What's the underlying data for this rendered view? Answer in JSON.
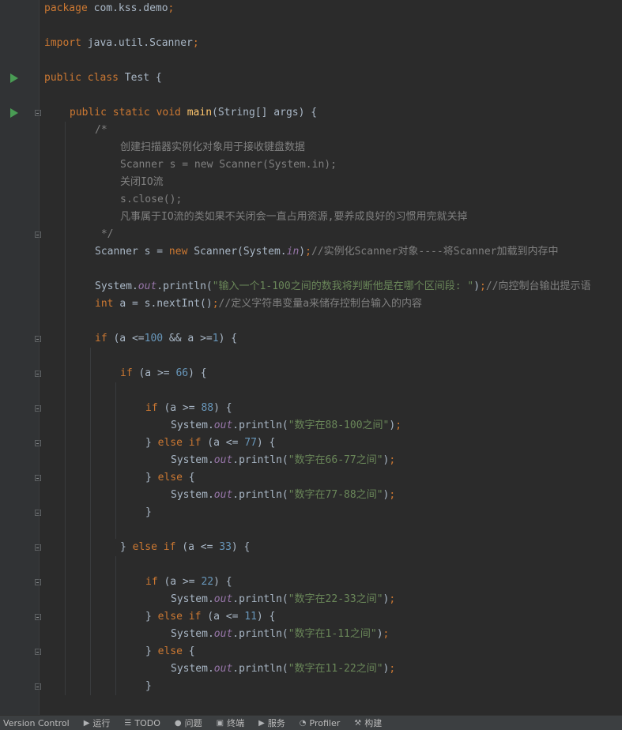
{
  "editor": {
    "lines": [
      {
        "indent": 0,
        "tokens": [
          {
            "t": "package ",
            "c": "kw"
          },
          {
            "t": "com.kss.demo",
            "c": "plain"
          },
          {
            "t": ";",
            "c": "kw"
          }
        ]
      },
      {
        "indent": 0,
        "tokens": []
      },
      {
        "indent": 0,
        "tokens": [
          {
            "t": "import ",
            "c": "kw"
          },
          {
            "t": "java.util.Scanner",
            "c": "plain"
          },
          {
            "t": ";",
            "c": "kw"
          }
        ]
      },
      {
        "indent": 0,
        "tokens": []
      },
      {
        "indent": 0,
        "tokens": [
          {
            "t": "public class ",
            "c": "kw"
          },
          {
            "t": "Test {",
            "c": "plain"
          }
        ]
      },
      {
        "indent": 0,
        "tokens": []
      },
      {
        "indent": 4,
        "tokens": [
          {
            "t": "public static void ",
            "c": "kw"
          },
          {
            "t": "main",
            "c": "fn"
          },
          {
            "t": "(String[] args) {",
            "c": "plain"
          }
        ]
      },
      {
        "indent": 8,
        "tokens": [
          {
            "t": "/*",
            "c": "cmt"
          }
        ]
      },
      {
        "indent": 12,
        "tokens": [
          {
            "t": "创建扫描器实例化对象用于接收键盘数据",
            "c": "cmt"
          }
        ]
      },
      {
        "indent": 12,
        "tokens": [
          {
            "t": "Scanner s = new Scanner(System.in);",
            "c": "cmt"
          }
        ]
      },
      {
        "indent": 12,
        "tokens": [
          {
            "t": "关闭IO流",
            "c": "cmt"
          }
        ]
      },
      {
        "indent": 12,
        "tokens": [
          {
            "t": "s.close();",
            "c": "cmt"
          }
        ]
      },
      {
        "indent": 12,
        "tokens": [
          {
            "t": "凡事属于IO流的类如果不关闭会一直占用资源,要养成良好的习惯用完就关掉",
            "c": "cmt"
          }
        ]
      },
      {
        "indent": 8,
        "tokens": [
          {
            "t": " */",
            "c": "cmt"
          }
        ]
      },
      {
        "indent": 8,
        "tokens": [
          {
            "t": "Scanner s = ",
            "c": "plain"
          },
          {
            "t": "new ",
            "c": "kw"
          },
          {
            "t": "Scanner(System.",
            "c": "plain"
          },
          {
            "t": "in",
            "c": "field"
          },
          {
            "t": ")",
            "c": "plain"
          },
          {
            "t": ";",
            "c": "kw"
          },
          {
            "t": "//实例化Scanner对象----将Scanner加载到内存中",
            "c": "cmt"
          }
        ]
      },
      {
        "indent": 0,
        "tokens": []
      },
      {
        "indent": 8,
        "tokens": [
          {
            "t": "System.",
            "c": "plain"
          },
          {
            "t": "out",
            "c": "field"
          },
          {
            "t": ".println(",
            "c": "plain"
          },
          {
            "t": "\"输入一个1-100之间的数我将判断他是在哪个区间段: \"",
            "c": "str"
          },
          {
            "t": ")",
            "c": "plain"
          },
          {
            "t": ";",
            "c": "kw"
          },
          {
            "t": "//向控制台输出提示语",
            "c": "cmt"
          }
        ]
      },
      {
        "indent": 8,
        "tokens": [
          {
            "t": "int ",
            "c": "kw"
          },
          {
            "t": "a = s.nextInt()",
            "c": "plain"
          },
          {
            "t": ";",
            "c": "kw"
          },
          {
            "t": "//定义字符串变量a来储存控制台输入的内容",
            "c": "cmt"
          }
        ]
      },
      {
        "indent": 0,
        "tokens": []
      },
      {
        "indent": 8,
        "tokens": [
          {
            "t": "if ",
            "c": "kw"
          },
          {
            "t": "(a <=",
            "c": "plain"
          },
          {
            "t": "100",
            "c": "num"
          },
          {
            "t": " && a >=",
            "c": "plain"
          },
          {
            "t": "1",
            "c": "num"
          },
          {
            "t": ") {",
            "c": "plain"
          }
        ]
      },
      {
        "indent": 0,
        "tokens": []
      },
      {
        "indent": 12,
        "tokens": [
          {
            "t": "if ",
            "c": "kw"
          },
          {
            "t": "(a >= ",
            "c": "plain"
          },
          {
            "t": "66",
            "c": "num"
          },
          {
            "t": ") {",
            "c": "plain"
          }
        ]
      },
      {
        "indent": 0,
        "tokens": []
      },
      {
        "indent": 16,
        "tokens": [
          {
            "t": "if ",
            "c": "kw"
          },
          {
            "t": "(a >= ",
            "c": "plain"
          },
          {
            "t": "88",
            "c": "num"
          },
          {
            "t": ") {",
            "c": "plain"
          }
        ]
      },
      {
        "indent": 20,
        "tokens": [
          {
            "t": "System.",
            "c": "plain"
          },
          {
            "t": "out",
            "c": "field"
          },
          {
            "t": ".println(",
            "c": "plain"
          },
          {
            "t": "\"数字在88-100之间\"",
            "c": "str"
          },
          {
            "t": ")",
            "c": "plain"
          },
          {
            "t": ";",
            "c": "kw"
          }
        ]
      },
      {
        "indent": 16,
        "tokens": [
          {
            "t": "} ",
            "c": "plain"
          },
          {
            "t": "else if ",
            "c": "kw"
          },
          {
            "t": "(a <= ",
            "c": "plain"
          },
          {
            "t": "77",
            "c": "num"
          },
          {
            "t": ") {",
            "c": "plain"
          }
        ]
      },
      {
        "indent": 20,
        "tokens": [
          {
            "t": "System.",
            "c": "plain"
          },
          {
            "t": "out",
            "c": "field"
          },
          {
            "t": ".println(",
            "c": "plain"
          },
          {
            "t": "\"数字在66-77之间\"",
            "c": "str"
          },
          {
            "t": ")",
            "c": "plain"
          },
          {
            "t": ";",
            "c": "kw"
          }
        ]
      },
      {
        "indent": 16,
        "tokens": [
          {
            "t": "} ",
            "c": "plain"
          },
          {
            "t": "else ",
            "c": "kw"
          },
          {
            "t": "{",
            "c": "plain"
          }
        ]
      },
      {
        "indent": 20,
        "tokens": [
          {
            "t": "System.",
            "c": "plain"
          },
          {
            "t": "out",
            "c": "field"
          },
          {
            "t": ".println(",
            "c": "plain"
          },
          {
            "t": "\"数字在77-88之间\"",
            "c": "str"
          },
          {
            "t": ")",
            "c": "plain"
          },
          {
            "t": ";",
            "c": "kw"
          }
        ]
      },
      {
        "indent": 16,
        "tokens": [
          {
            "t": "}",
            "c": "plain"
          }
        ]
      },
      {
        "indent": 0,
        "tokens": []
      },
      {
        "indent": 12,
        "tokens": [
          {
            "t": "} ",
            "c": "plain"
          },
          {
            "t": "else if ",
            "c": "kw"
          },
          {
            "t": "(a <= ",
            "c": "plain"
          },
          {
            "t": "33",
            "c": "num"
          },
          {
            "t": ") {",
            "c": "plain"
          }
        ]
      },
      {
        "indent": 0,
        "tokens": []
      },
      {
        "indent": 16,
        "tokens": [
          {
            "t": "if ",
            "c": "kw"
          },
          {
            "t": "(a >= ",
            "c": "plain"
          },
          {
            "t": "22",
            "c": "num"
          },
          {
            "t": ") {",
            "c": "plain"
          }
        ]
      },
      {
        "indent": 20,
        "tokens": [
          {
            "t": "System.",
            "c": "plain"
          },
          {
            "t": "out",
            "c": "field"
          },
          {
            "t": ".println(",
            "c": "plain"
          },
          {
            "t": "\"数字在22-33之间\"",
            "c": "str"
          },
          {
            "t": ")",
            "c": "plain"
          },
          {
            "t": ";",
            "c": "kw"
          }
        ]
      },
      {
        "indent": 16,
        "tokens": [
          {
            "t": "} ",
            "c": "plain"
          },
          {
            "t": "else if ",
            "c": "kw"
          },
          {
            "t": "(a <= ",
            "c": "plain"
          },
          {
            "t": "11",
            "c": "num"
          },
          {
            "t": ") {",
            "c": "plain"
          }
        ]
      },
      {
        "indent": 20,
        "tokens": [
          {
            "t": "System.",
            "c": "plain"
          },
          {
            "t": "out",
            "c": "field"
          },
          {
            "t": ".println(",
            "c": "plain"
          },
          {
            "t": "\"数字在1-11之间\"",
            "c": "str"
          },
          {
            "t": ")",
            "c": "plain"
          },
          {
            "t": ";",
            "c": "kw"
          }
        ]
      },
      {
        "indent": 16,
        "tokens": [
          {
            "t": "} ",
            "c": "plain"
          },
          {
            "t": "else ",
            "c": "kw"
          },
          {
            "t": "{",
            "c": "plain"
          }
        ]
      },
      {
        "indent": 20,
        "tokens": [
          {
            "t": "System.",
            "c": "plain"
          },
          {
            "t": "out",
            "c": "field"
          },
          {
            "t": ".println(",
            "c": "plain"
          },
          {
            "t": "\"数字在11-22之间\"",
            "c": "str"
          },
          {
            "t": ")",
            "c": "plain"
          },
          {
            "t": ";",
            "c": "kw"
          }
        ]
      },
      {
        "indent": 16,
        "tokens": [
          {
            "t": "}",
            "c": "plain"
          }
        ]
      }
    ],
    "run_markers": [
      4,
      6
    ],
    "fold_markers": [
      6,
      13,
      19,
      21,
      23,
      25,
      27,
      29,
      31,
      33,
      35,
      37,
      39
    ],
    "indent_guides": [
      {
        "level": 4,
        "from": 7,
        "to": 40
      },
      {
        "level": 8,
        "from": 20,
        "to": 40
      },
      {
        "level": 12,
        "from": 22,
        "to": 31
      },
      {
        "level": 12,
        "from": 32,
        "to": 40
      }
    ],
    "colors": {
      "background": "#2b2b2b",
      "gutter": "#313335",
      "keyword": "#cc7832",
      "function": "#ffc66d",
      "number": "#6897bb",
      "string": "#6a8759",
      "field": "#9876aa",
      "comment": "#808080",
      "plain": "#a9b7c6",
      "run_icon": "#499c54"
    }
  },
  "statusbar": {
    "items": [
      {
        "name": "version-control",
        "icon": "",
        "icon_name": "",
        "label": "Version Control"
      },
      {
        "name": "run",
        "icon": "▶",
        "icon_name": "run-icon",
        "label": "运行"
      },
      {
        "name": "todo",
        "icon": "☰",
        "icon_name": "todo-list-icon",
        "label": "TODO"
      },
      {
        "name": "problems",
        "icon": "●",
        "icon_name": "problems-icon",
        "label": "问题"
      },
      {
        "name": "terminal",
        "icon": "▣",
        "icon_name": "terminal-icon",
        "label": "终端"
      },
      {
        "name": "services",
        "icon": "▶",
        "icon_name": "services-icon",
        "label": "服务"
      },
      {
        "name": "profiler",
        "icon": "◔",
        "icon_name": "profiler-icon",
        "label": "Profiler"
      },
      {
        "name": "build",
        "icon": "⚒",
        "icon_name": "build-hammer-icon",
        "label": "构建"
      }
    ]
  }
}
